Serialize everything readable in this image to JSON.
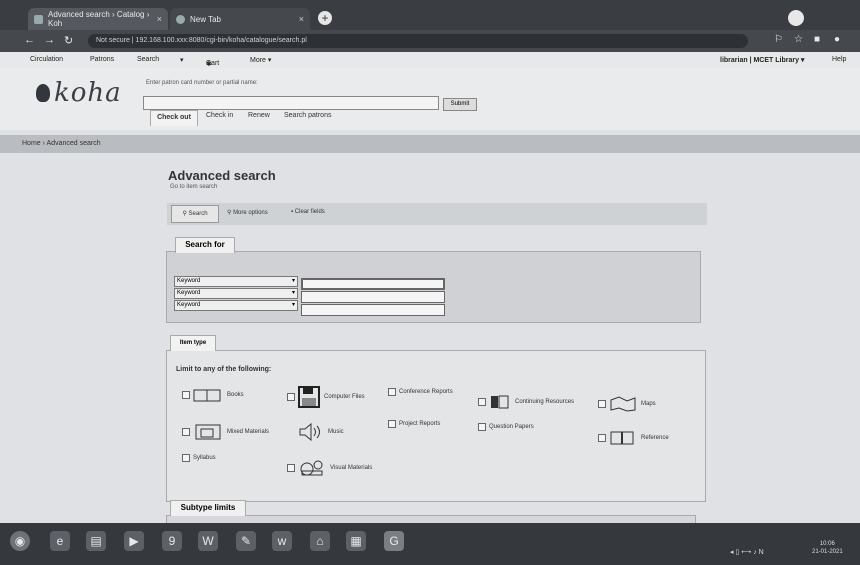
{
  "browser": {
    "tabs": [
      {
        "label": "Advanced search › Catalog › Koh"
      },
      {
        "label": "New Tab"
      }
    ],
    "url": "Not secure | 192.168.100.xxx:8080/cgi-bin/koha/catalogue/search.pl",
    "url_prefix": "Not secure"
  },
  "koha_nav": {
    "items": [
      "Circulation",
      "Patrons",
      "Search",
      "▾",
      "Cart",
      "More ▾"
    ],
    "user": "librarian | MCET Library ▾",
    "help": "Help"
  },
  "header": {
    "logo": "koha",
    "hint": "Enter patron card number or partial name:",
    "submit": "Submit",
    "circ_tabs": [
      "Check out",
      "Check in",
      "Renew",
      "Search patrons"
    ]
  },
  "breadcrumbs": "Home › Advanced search",
  "page": {
    "title": "Advanced search",
    "subtitle": "Go to item search",
    "toolbar": {
      "search": "Search",
      "more_options": "More options",
      "clear": "Clear fields"
    },
    "search_for": {
      "legend": "Search for",
      "rows": [
        {
          "index": "Keyword"
        },
        {
          "index": "Keyword"
        },
        {
          "index": "Keyword"
        }
      ]
    },
    "item_type": {
      "tab": "Item type",
      "limit_label": "Limit to any of the following:",
      "types": [
        {
          "label": "Books",
          "icon": "book-icon"
        },
        {
          "label": "Computer Files",
          "icon": "floppy-disk-icon"
        },
        {
          "label": "Conference Reports",
          "icon": ""
        },
        {
          "label": "Continuing Resources",
          "icon": "journal-icon"
        },
        {
          "label": "Maps",
          "icon": "map-icon"
        },
        {
          "label": "Mixed Materials",
          "icon": "mixed-materials-icon"
        },
        {
          "label": "Music",
          "icon": "speaker-icon"
        },
        {
          "label": "Project Reports",
          "icon": ""
        },
        {
          "label": "Question Papers",
          "icon": ""
        },
        {
          "label": "Reference",
          "icon": "reference-icon"
        },
        {
          "label": "Syllabus",
          "icon": ""
        },
        {
          "label": "Visual Materials",
          "icon": "visual-materials-icon"
        }
      ]
    },
    "subtype": {
      "legend": "Subtype limits"
    }
  },
  "taskbar": {
    "tray": "◂ ▯ ⟷ ♪ N",
    "time": "10:06",
    "date": "21-01-2021"
  },
  "colors": {
    "chrome_dark": "#3a3d42",
    "page_bg": "#dfe1e4",
    "breadcrumb_bg": "#b9bcc0"
  }
}
